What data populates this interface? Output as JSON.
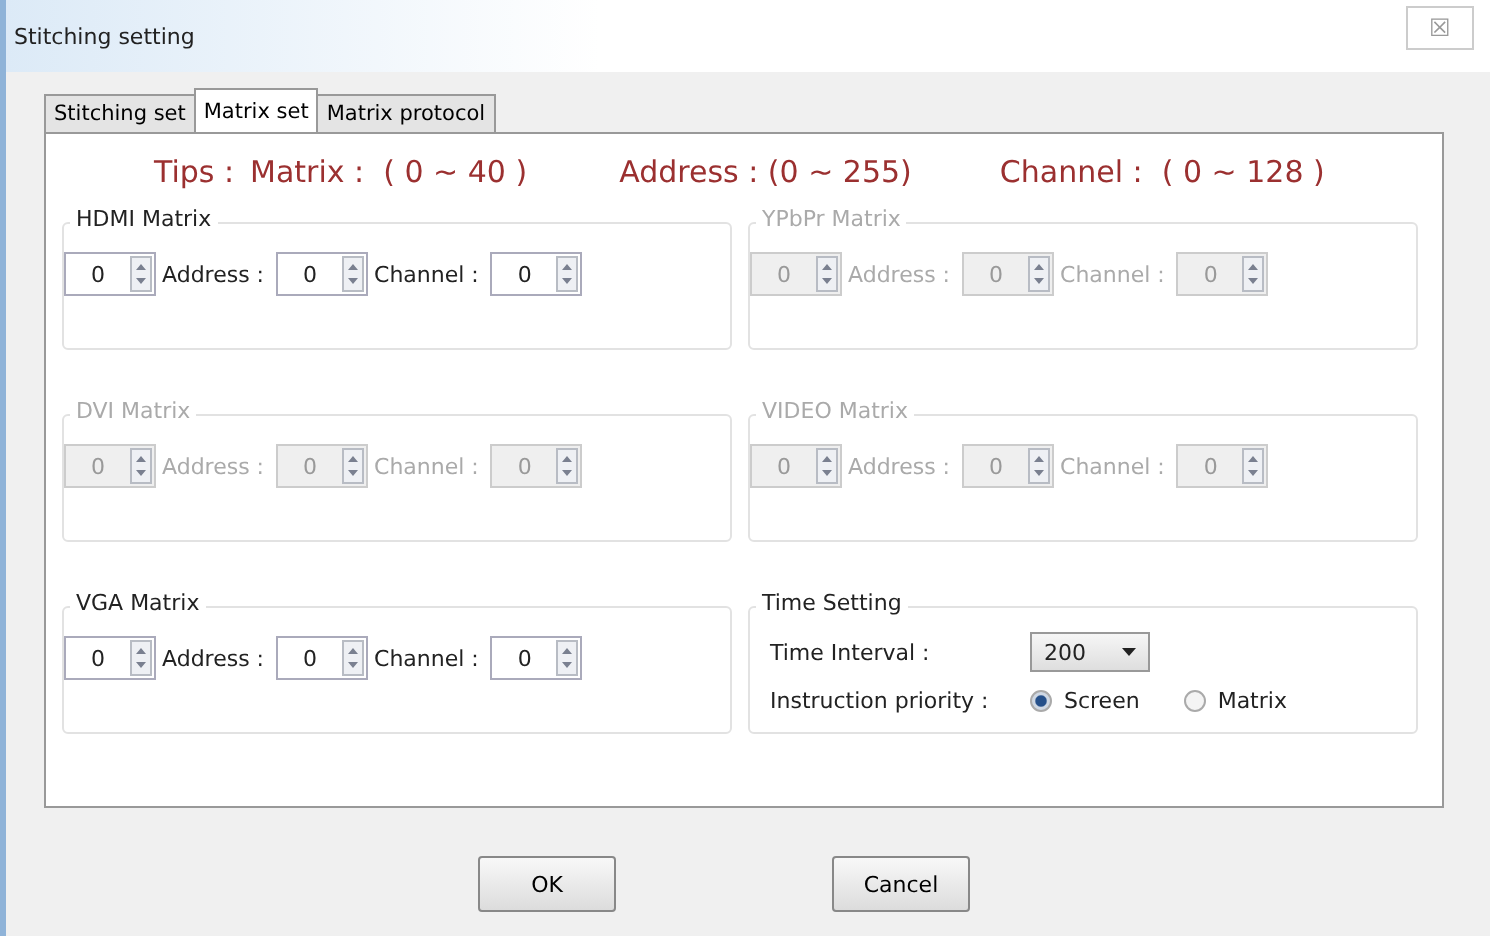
{
  "window": {
    "title": "Stitching setting",
    "close": "☒"
  },
  "tabs": [
    {
      "label": "Stitching set",
      "selected": false
    },
    {
      "label": "Matrix set",
      "selected": true
    },
    {
      "label": "Matrix protocol",
      "selected": false
    }
  ],
  "tips": [
    "Tips :",
    "Matrix :  ( 0 ~ 40 )",
    "Address : (0 ~ 255)",
    "Channel :  ( 0 ~ 128 )"
  ],
  "groups": [
    {
      "kind": "matrix",
      "title": "HDMI Matrix",
      "disabled": false,
      "fields": [
        {
          "value": "0"
        },
        {
          "label": "Address :",
          "value": "0"
        },
        {
          "label": "Channel :",
          "value": "0"
        }
      ]
    },
    {
      "kind": "matrix",
      "title": "YPbPr Matrix",
      "disabled": true,
      "fields": [
        {
          "value": "0"
        },
        {
          "label": "Address :",
          "value": "0"
        },
        {
          "label": "Channel :",
          "value": "0"
        }
      ]
    },
    {
      "kind": "matrix",
      "title": "DVI Matrix",
      "disabled": true,
      "fields": [
        {
          "value": "0"
        },
        {
          "label": "Address :",
          "value": "0"
        },
        {
          "label": "Channel :",
          "value": "0"
        }
      ]
    },
    {
      "kind": "matrix",
      "title": "VIDEO Matrix",
      "disabled": true,
      "fields": [
        {
          "value": "0"
        },
        {
          "label": "Address :",
          "value": "0"
        },
        {
          "label": "Channel :",
          "value": "0"
        }
      ]
    },
    {
      "kind": "matrix",
      "title": "VGA Matrix",
      "disabled": false,
      "fields": [
        {
          "value": "0"
        },
        {
          "label": "Address :",
          "value": "0"
        },
        {
          "label": "Channel :",
          "value": "0"
        }
      ]
    },
    {
      "kind": "time",
      "title": "Time Setting",
      "interval_label": "Time Interval :",
      "interval_value": "200",
      "priority_label": "Instruction priority :",
      "options": [
        {
          "label": "Screen",
          "selected": true
        },
        {
          "label": "Matrix",
          "selected": false
        }
      ]
    }
  ],
  "buttons": [
    "OK",
    "Cancel"
  ]
}
